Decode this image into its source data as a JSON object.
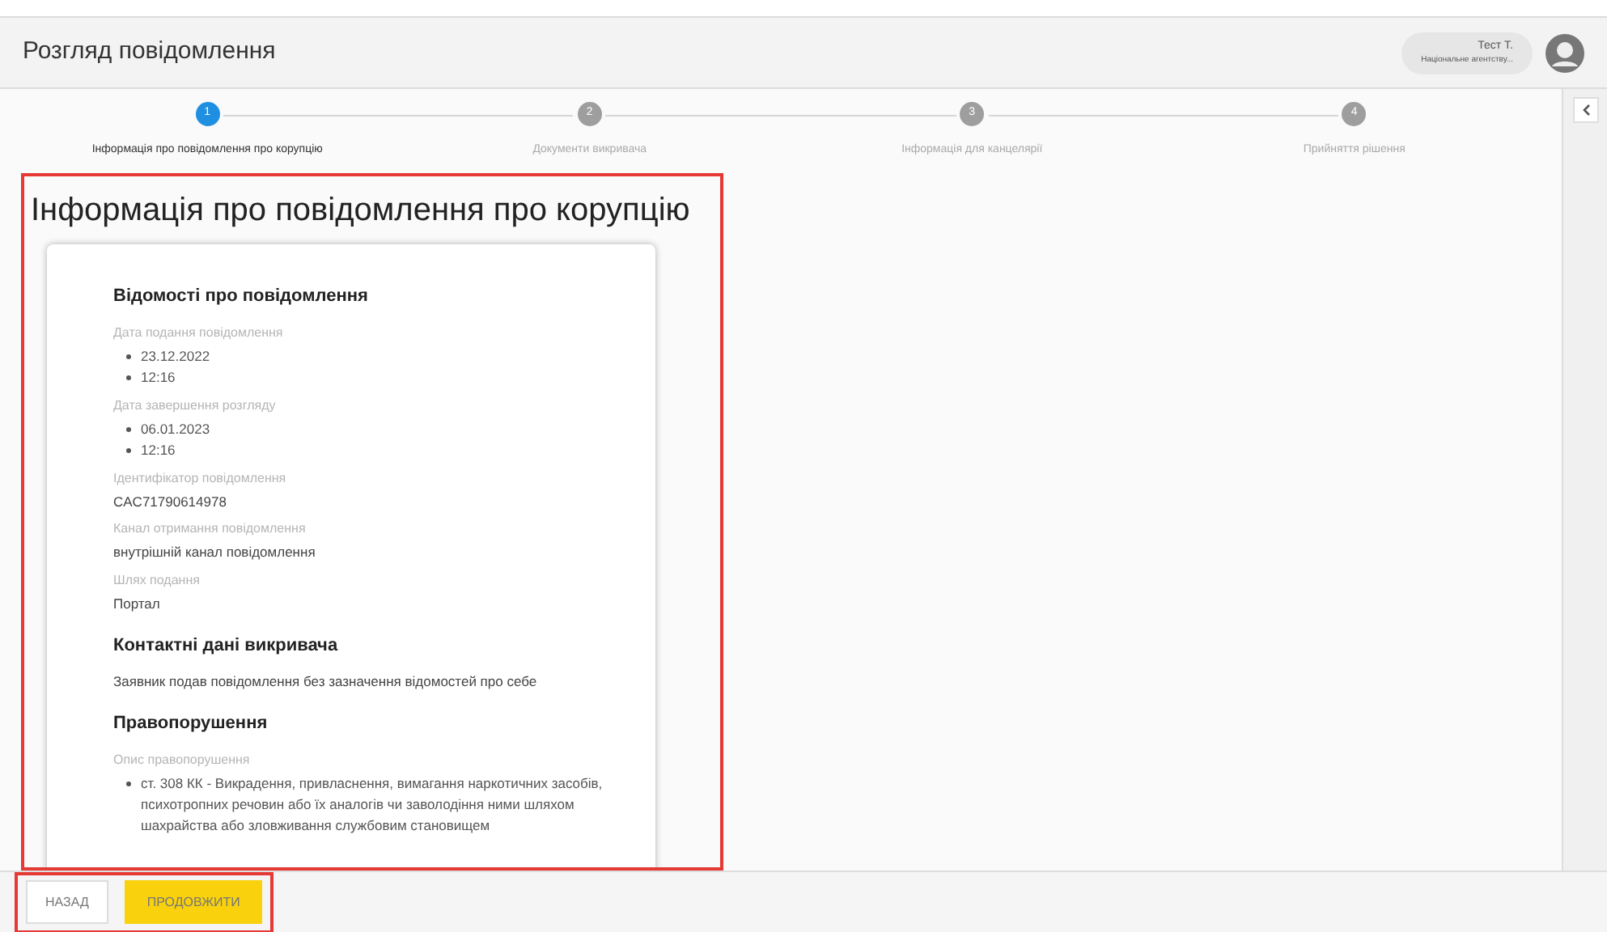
{
  "header": {
    "title": "Розгляд повідомлення",
    "user": {
      "name": "Тест Т.",
      "org": "Національне агентству..."
    }
  },
  "steps": [
    {
      "number": "1",
      "label": "Інформація про повідомлення про корупцію",
      "selected": true
    },
    {
      "number": "2",
      "label": "Документи викривача",
      "selected": false
    },
    {
      "number": "3",
      "label": "Інформація для канцелярії",
      "selected": false
    },
    {
      "number": "4",
      "label": "Прийняття рішення",
      "selected": false
    }
  ],
  "page_title": "Інформація про повідомлення про корупцію",
  "sections": [
    {
      "heading": "Відомості про повідомлення",
      "fields": [
        {
          "kind": "list",
          "label": "Дата подання повідомлення",
          "values": [
            "23.12.2022",
            "12:16"
          ]
        },
        {
          "kind": "list",
          "label": "Дата завершення розгляду",
          "values": [
            "06.01.2023",
            "12:16"
          ]
        },
        {
          "kind": "text",
          "label": "Ідентифікатор повідомлення",
          "value": "CAC71790614978"
        },
        {
          "kind": "text",
          "label": "Канал отримання повідомлення",
          "value": "внутрішній канал повідомлення"
        },
        {
          "kind": "text",
          "label": "Шлях подання",
          "value": "Портал"
        }
      ]
    },
    {
      "heading": "Контактні дані викривача",
      "fields": [
        {
          "kind": "text",
          "value": "Заявник подав повідомлення без зазначення відомостей про себе"
        }
      ]
    },
    {
      "heading": "Правопорушення",
      "fields": [
        {
          "kind": "list",
          "label": "Опис правопорушення",
          "values": [
            "ст. 308 КК - Викрадення, привласнення, вимагання наркотичних засобів, психотропних речовин або їх аналогів чи заволодіння ними шляхом шахрайства або зловживання службовим становищем"
          ]
        }
      ]
    }
  ],
  "buttons": [
    {
      "label": "НАЗАД",
      "kind": "secondary"
    },
    {
      "label": "ПРОДОВЖИТИ",
      "kind": "primary"
    }
  ]
}
